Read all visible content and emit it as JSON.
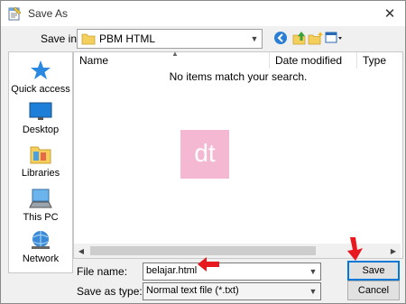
{
  "window": {
    "title": "Save As",
    "close_glyph": "✕"
  },
  "toolbar": {
    "save_in_label": "Save in:",
    "current_folder": "PBM HTML",
    "icons": [
      "back-icon",
      "up-folder-icon",
      "new-folder-icon",
      "view-menu-icon"
    ]
  },
  "sidebar": {
    "items": [
      {
        "label": "Quick access",
        "icon": "star-icon"
      },
      {
        "label": "Desktop",
        "icon": "desktop-icon"
      },
      {
        "label": "Libraries",
        "icon": "libraries-icon"
      },
      {
        "label": "This PC",
        "icon": "computer-icon"
      },
      {
        "label": "Network",
        "icon": "network-icon"
      }
    ]
  },
  "filelist": {
    "columns": [
      "Name",
      "Date modified",
      "Type"
    ],
    "empty_message": "No items match your search.",
    "watermark": "dt"
  },
  "form": {
    "filename_label": "File name:",
    "filename_value": "belajar.html",
    "savetype_label": "Save as type:",
    "savetype_value": "Normal text file (*.txt)"
  },
  "buttons": {
    "save": "Save",
    "cancel": "Cancel"
  },
  "colors": {
    "accent": "#0078d7",
    "annotation_arrow": "#e8191e",
    "watermark_bg": "#f4b8d2"
  }
}
